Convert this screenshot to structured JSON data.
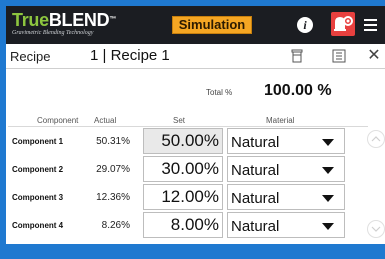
{
  "header": {
    "logo_name": "TrueBLEND",
    "logo_name_accent": "True",
    "logo_name_rest": "BLEND",
    "logo_tm": "™",
    "logo_subtitle": "Gravimetric Blending Technology",
    "mode_badge": "Simulation",
    "icons": [
      "info-icon",
      "alarm-settings-icon",
      "menu-icon"
    ]
  },
  "recipe_bar": {
    "label": "Recipe",
    "recipe_title": "1 | Recipe 1",
    "icons": [
      "trash-icon",
      "document-icon",
      "close-icon"
    ]
  },
  "total": {
    "label": "Total %",
    "value": "100.00 %"
  },
  "table": {
    "headers": [
      "Component",
      "Actual",
      "Set",
      "Material"
    ],
    "rows": [
      {
        "component": "Component 1",
        "actual": "50.31%",
        "set": "50.00%",
        "material": "Natural"
      },
      {
        "component": "Component 2",
        "actual": "29.07%",
        "set": "30.00%",
        "material": "Natural"
      },
      {
        "component": "Component 3",
        "actual": "12.36%",
        "set": "12.00%",
        "material": "Natural"
      },
      {
        "component": "Component 4",
        "actual": "8.26%",
        "set": "8.00%",
        "material": "Natural"
      }
    ]
  },
  "colors": {
    "frame": "#1f79d0",
    "topbar": "#1b1d22",
    "badge": "#f5a623",
    "alarm": "#e8403f",
    "logo_accent": "#8dc63f"
  }
}
